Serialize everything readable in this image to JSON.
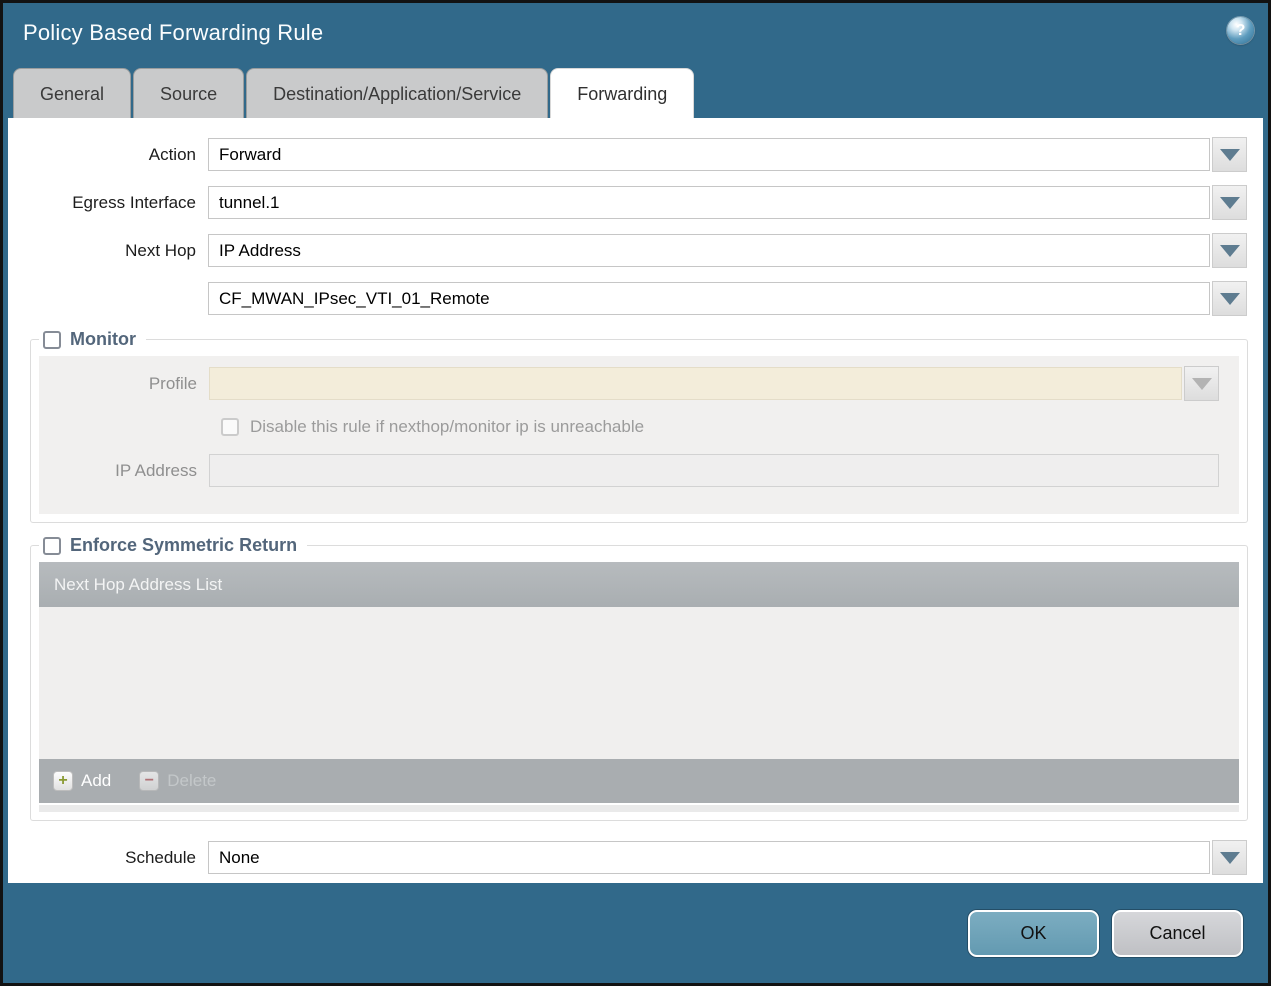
{
  "dialog": {
    "title": "Policy Based Forwarding Rule"
  },
  "icons": {
    "help": "?",
    "add_plus": "+",
    "delete_minus": "−"
  },
  "tabs": [
    {
      "label": "General",
      "active": false
    },
    {
      "label": "Source",
      "active": false
    },
    {
      "label": "Destination/Application/Service",
      "active": false
    },
    {
      "label": "Forwarding",
      "active": true
    }
  ],
  "form": {
    "action": {
      "label": "Action",
      "value": "Forward"
    },
    "egress_interface": {
      "label": "Egress Interface",
      "value": "tunnel.1"
    },
    "next_hop": {
      "label": "Next Hop",
      "value": "IP Address"
    },
    "next_hop_address": {
      "value": "CF_MWAN_IPsec_VTI_01_Remote"
    },
    "schedule": {
      "label": "Schedule",
      "value": "None"
    }
  },
  "monitor": {
    "legend": "Monitor",
    "checked": false,
    "profile": {
      "label": "Profile",
      "value": ""
    },
    "disable_rule": {
      "label": "Disable this rule if nexthop/monitor ip is unreachable",
      "checked": false
    },
    "ip_address": {
      "label": "IP Address",
      "value": ""
    }
  },
  "symmetric_return": {
    "legend": "Enforce Symmetric Return",
    "checked": false,
    "table_header": "Next Hop Address List",
    "rows": [],
    "add_label": "Add",
    "delete_label": "Delete"
  },
  "footer": {
    "ok_label": "OK",
    "cancel_label": "Cancel"
  },
  "colors": {
    "titlebar_teal": "#31698a",
    "active_tab": "#ffffff",
    "inactive_tab": "#c9cacb",
    "disabled_field_beige": "#f3edda",
    "table_header_gray": "#aeb2b5",
    "add_plus_green": "#8a9a33",
    "delete_minus_red": "#b2595e",
    "ok_button_blue": "#6ea3bb",
    "cancel_button_gray": "#c8c9cc"
  }
}
